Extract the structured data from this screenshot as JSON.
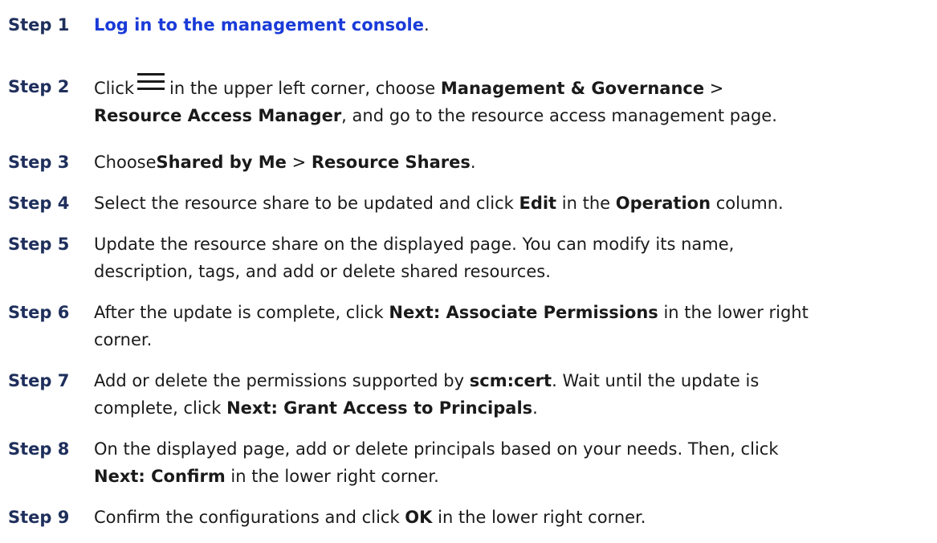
{
  "steps": [
    {
      "label": "Step 1",
      "link": "Log in to the management console",
      "tail": "."
    },
    {
      "label": "Step 2",
      "t1": "Click",
      "icon": "menu-icon",
      "t2": "in the upper left corner, choose",
      "b1": "Management & Governance",
      "t3": ">",
      "b2": "Resource Access Manager",
      "t4": ", and go to the resource access management page."
    },
    {
      "label": "Step 3",
      "t1": "Choose",
      "b1": "Shared by Me",
      "t2": ">",
      "b2": "Resource Shares",
      "t3": "."
    },
    {
      "label": "Step 4",
      "t1": "Select the resource share to be updated and click",
      "b1": "Edit",
      "t2": "in the",
      "b2": "Operation",
      "t3": "column."
    },
    {
      "label": "Step 5",
      "line1": "Update the resource share on the displayed page. You can modify its name,",
      "line2": "description, tags, and add or delete shared resources."
    },
    {
      "label": "Step 6",
      "t1": "After the update is complete, click",
      "b1": "Next: Associate Permissions",
      "t2": "in the lower right",
      "t3": "corner."
    },
    {
      "label": "Step 7",
      "t1": "Add or delete the permissions supported by",
      "b1": "scm:cert",
      "t2": ". Wait until the update is",
      "t3": "complete, click",
      "b2": "Next: Grant Access to Principals",
      "t4": "."
    },
    {
      "label": "Step 8",
      "t1": "On the displayed page, add or delete principals based on your needs. Then, click",
      "b1": "Next: Confirm",
      "t2": "in the lower right corner."
    },
    {
      "label": "Step 9",
      "t1": "Confirm the configurations and click",
      "b1": "OK",
      "t2": "in the lower right corner."
    }
  ]
}
